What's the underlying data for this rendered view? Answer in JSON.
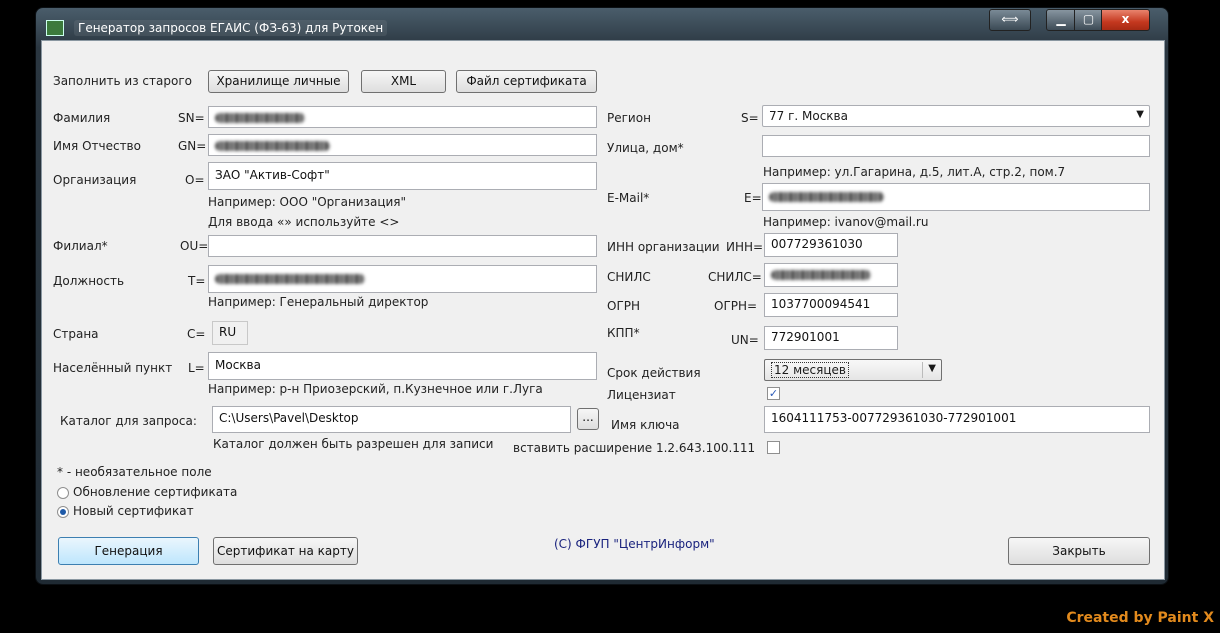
{
  "window": {
    "title": "Генератор запросов ЕГАИС (ФЗ-63) для Рутокен",
    "controls": {
      "resize_glyph": "⟺",
      "minimize_glyph": "▁",
      "maximize_glyph": "▢",
      "close_glyph": "x"
    }
  },
  "top": {
    "fill_from_old_label": "Заполнить из старого",
    "buttons": [
      "Хранилище личные",
      "XML",
      "Файл сертификата"
    ]
  },
  "left": {
    "surname": {
      "label": "Фамилия",
      "code": "SN=",
      "value": ""
    },
    "name": {
      "label": "Имя Отчество",
      "code": "GN=",
      "value": ""
    },
    "org": {
      "label": "Организация",
      "code": "O=",
      "value": "ЗАО \"Актив-Софт\"",
      "hint1": "Например: ООО \"Организация\"",
      "hint2": "Для ввода «» используйте <>"
    },
    "branch": {
      "label": "Филиал*",
      "code": "OU=",
      "value": ""
    },
    "position": {
      "label": "Должность",
      "code": "T=",
      "value": "",
      "hint": "Например: Генеральный директор"
    },
    "country": {
      "label": "Страна",
      "code": "C=",
      "value": "RU"
    },
    "locality": {
      "label": "Населённый пункт",
      "code": "L=",
      "value": "Москва",
      "hint": "Например: р-н Приозерский, п.Кузнечное или г.Луга"
    },
    "catalog": {
      "label": "Каталог для запроса:",
      "value": "C:\\Users\\Pavel\\Desktop",
      "browse": "...",
      "hint": "Каталог должен быть разрешен для записи"
    },
    "optional_note": "* - необязательное поле",
    "radios": [
      {
        "label": "Обновление сертификата",
        "selected": false
      },
      {
        "label": "Новый сертификат",
        "selected": true
      }
    ]
  },
  "right": {
    "region": {
      "label": "Регион",
      "code": "S=",
      "value": "77 г. Москва"
    },
    "street": {
      "label": "Улица, дом*",
      "value": "",
      "hint": "Например: ул.Гагарина, д.5, лит.А, стр.2, пом.7"
    },
    "email": {
      "label": "E-Mail*",
      "code": "E=",
      "value": "",
      "hint": "Например: ivanov@mail.ru"
    },
    "inn": {
      "label": "ИНН организации",
      "code": "ИНН=",
      "value": "007729361030"
    },
    "snils": {
      "label": "СНИЛС",
      "code": "СНИЛС=",
      "value": ""
    },
    "ogrn": {
      "label": "ОГРН",
      "code": "ОГРН=",
      "value": "1037700094541"
    },
    "kpp": {
      "label": "КПП*",
      "code": "UN=",
      "value": "772901001"
    },
    "validity": {
      "label": "Срок действия",
      "value": "12 месяцев"
    },
    "licensee": {
      "label": "Лицензиат",
      "checked": true
    },
    "key_name": {
      "label": "Имя ключа",
      "value": "1604111753-007729361030-772901001"
    },
    "extension": {
      "label": "вставить расширение 1.2.643.100.111",
      "checked": false
    }
  },
  "bottom": {
    "generate": "Генерация",
    "cert_to_card": "Сертификат на карту",
    "copyright": "(С) ФГУП \"ЦентрИнформ\"",
    "close": "Закрыть"
  },
  "watermark": "Created by Paint X"
}
